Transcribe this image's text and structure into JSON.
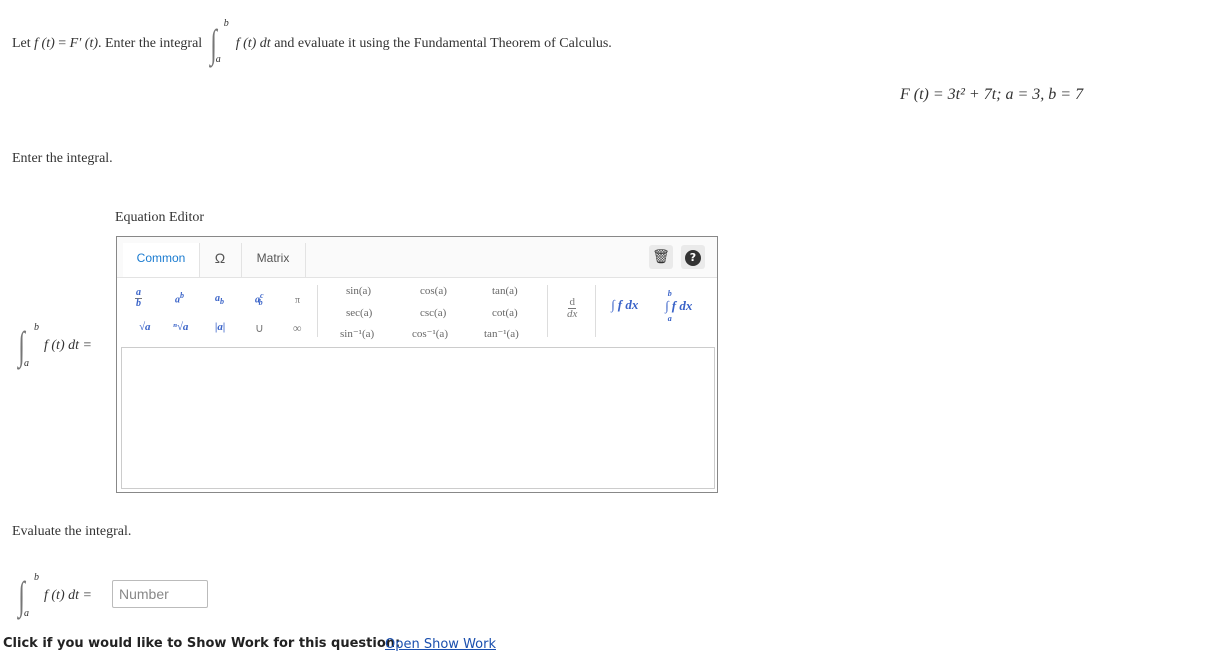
{
  "question": {
    "prefix_let": "Let",
    "f_of_t": "f (t)",
    "equals": " = ",
    "F_prime": "F′ (t)",
    "suffix_enter": ". Enter the integral",
    "integrand": "f (t) dt",
    "suffix_evaluate": "and evaluate it using the Fundamental Theorem of Calculus.",
    "upper_limit": "b",
    "lower_limit": "a"
  },
  "given": "F (t) = 3t² + 7t; a = 3, b = 7",
  "enter_integral_label": "Enter the integral.",
  "equation_editor": {
    "title": "Equation Editor",
    "tabs": [
      {
        "label": "Common"
      },
      {
        "label": "Ω"
      },
      {
        "label": "Matrix"
      }
    ],
    "trash_icon": "trash-icon",
    "help_icon": "help-icon",
    "toolbar": {
      "frac_num": "a",
      "frac_den": "b",
      "power_base": "a",
      "power_exp": "b",
      "subscript_base": "a",
      "subscript_sub": "b",
      "supsub_base": "a",
      "supsub_sup": "c",
      "supsub_sub": "b",
      "pi": "π",
      "sqrt": "√a",
      "nthroot": "ⁿ√a",
      "abs": "|a|",
      "union": "∪",
      "infinity": "∞",
      "sin": "sin(a)",
      "cos": "cos(a)",
      "tan": "tan(a)",
      "sec": "sec(a)",
      "csc": "csc(a)",
      "cot": "cot(a)",
      "asin": "sin⁻¹(a)",
      "acos": "cos⁻¹(a)",
      "atan": "tan⁻¹(a)",
      "deriv_num": "d",
      "deriv_den": "dx",
      "indef_integral": "∫ f dx",
      "def_integral": "∫ f dx",
      "def_upper": "b",
      "def_lower": "a"
    }
  },
  "answer_prefix": "f (t) dt =",
  "evaluate_label": "Evaluate the integral.",
  "number_input": {
    "value": "",
    "placeholder": "Number"
  },
  "show_work": {
    "prompt": "Click if you would like to Show Work for this question:",
    "link": "Open Show Work"
  }
}
